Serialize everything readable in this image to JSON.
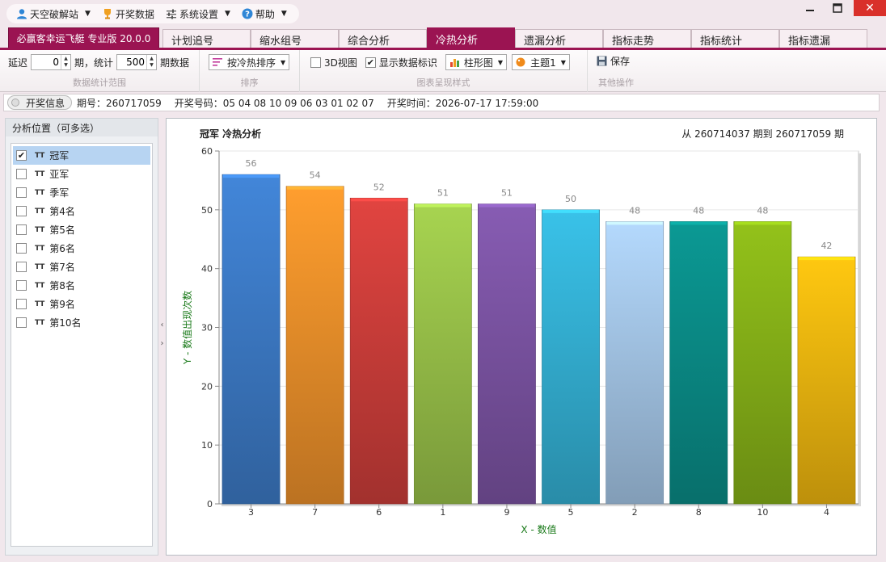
{
  "menubar": {
    "items": [
      {
        "label": "天空破解站",
        "icon": "user-icon",
        "has_caret": true
      },
      {
        "label": "开奖数据",
        "icon": "trophy-icon",
        "has_caret": false
      },
      {
        "label": "系统设置",
        "icon": "settings-sliders-icon",
        "has_caret": true
      },
      {
        "label": "帮助",
        "icon": "help-icon",
        "has_caret": true
      }
    ]
  },
  "tabs": {
    "brand": "必赢客幸运飞艇 专业版 20.0.0",
    "items": [
      "计划追号",
      "缩水组号",
      "综合分析",
      "冷热分析",
      "遗漏分析",
      "指标走势",
      "指标统计",
      "指标遗漏"
    ],
    "active": "冷热分析"
  },
  "toolbar": {
    "delay_label": "延迟",
    "delay_value": "0",
    "period_label": "期，统计",
    "stat_value": "500",
    "data_label": "期数据",
    "group1_title": "数据统计范围",
    "sort_label": "按冷热排序",
    "group2_title": "排序",
    "view3d_label": "3D视图",
    "view3d_checked": false,
    "show_labels_label": "显示数据标识",
    "show_labels_checked": true,
    "chart_type_label": "柱形图",
    "theme_label": "主题1",
    "group3_title": "图表呈现样式",
    "save_label": "保存",
    "group4_title": "其他操作"
  },
  "info": {
    "button_label": "开奖信息",
    "period_text": "期号：260717059",
    "numbers_text": "开奖号码：05 04 08 10 09 06 03 01 02 07",
    "time_text": "开奖时间：2026-07-17 17:59:00"
  },
  "left_panel": {
    "title": "分析位置（可多选）",
    "items": [
      {
        "label": "冠军",
        "checked": true
      },
      {
        "label": "亚军",
        "checked": false
      },
      {
        "label": "季军",
        "checked": false
      },
      {
        "label": "第4名",
        "checked": false
      },
      {
        "label": "第5名",
        "checked": false
      },
      {
        "label": "第6名",
        "checked": false
      },
      {
        "label": "第7名",
        "checked": false
      },
      {
        "label": "第8名",
        "checked": false
      },
      {
        "label": "第9名",
        "checked": false
      },
      {
        "label": "第10名",
        "checked": false
      }
    ]
  },
  "chart_panel": {
    "title": "冠军 冷热分析",
    "range_text": "从 260714037 期到 260717059 期"
  },
  "chart_data": {
    "type": "bar",
    "title": "冠军 冷热分析",
    "categories": [
      "3",
      "7",
      "6",
      "1",
      "9",
      "5",
      "2",
      "8",
      "10",
      "4"
    ],
    "values": [
      56,
      54,
      52,
      51,
      51,
      50,
      48,
      48,
      48,
      42
    ],
    "colors": [
      "#3d7cc9",
      "#f0922b",
      "#d03f3b",
      "#9bc44a",
      "#7d55a6",
      "#35b4d8",
      "#a7c9ea",
      "#0a8e89",
      "#88b418",
      "#f2b90f"
    ],
    "xlabel": "X - 数值",
    "ylabel": "Y - 数值出现次数",
    "ylim": [
      0,
      60
    ],
    "yticks": [
      0,
      10,
      20,
      30,
      40,
      50,
      60
    ],
    "grid": true,
    "show_data_labels": true
  }
}
